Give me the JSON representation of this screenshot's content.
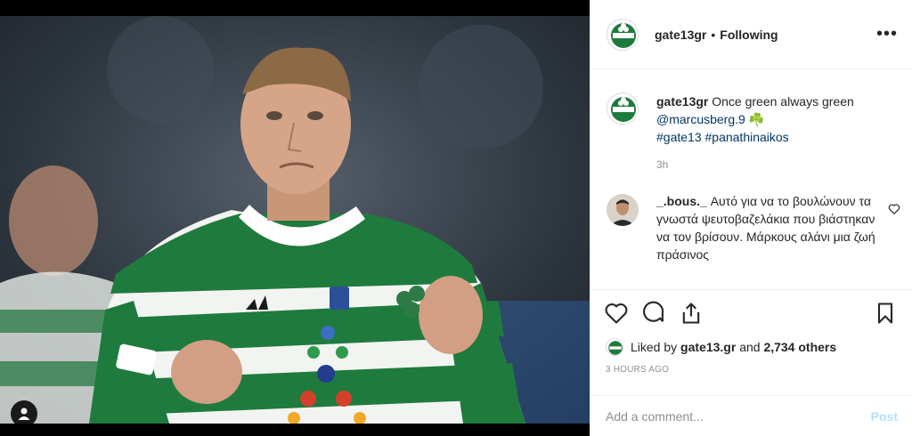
{
  "post": {
    "author": "gate13gr",
    "separator": "•",
    "follow_state": "Following",
    "more_label": "•••"
  },
  "caption": {
    "username": "gate13gr",
    "text": "Once green always green",
    "mention": "@marcusberg.9",
    "emoji": "☘️",
    "hashtag1": "#gate13",
    "hashtag2": "#panathinaikos",
    "time": "3h"
  },
  "comment": {
    "username": "_.bous._",
    "text": "Αυτό για να το βουλώνουν τα γνωστά ψευτοβαζελάκια που βιάστηκαν να τον βρίσουν. Μάρκους αλάνι μια ζωή πράσινος"
  },
  "likes": {
    "prefix": "Liked by",
    "user": "gate13.gr",
    "conj": "and",
    "others": "2,734 others"
  },
  "posted_ago": "3 HOURS AGO",
  "add_comment": {
    "placeholder": "Add a comment...",
    "post_label": "Post"
  },
  "icons": [
    "heart-icon",
    "comment-icon",
    "share-icon",
    "bookmark-icon",
    "user-tag-icon",
    "more-icon"
  ],
  "colors": {
    "kit_green": "#1f7a3e",
    "link": "#003569",
    "muted": "#8e8e8e",
    "post_disabled": "#b2dffc"
  }
}
